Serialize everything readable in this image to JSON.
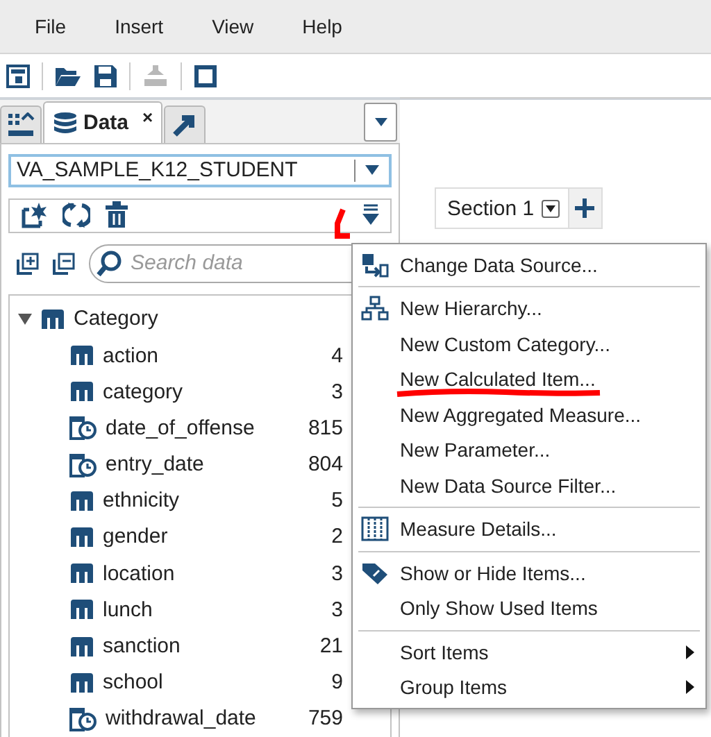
{
  "menu_bar": [
    {
      "label": "File"
    },
    {
      "label": "Insert"
    },
    {
      "label": "View"
    },
    {
      "label": "Help"
    }
  ],
  "toolbar": [
    {
      "kind": "report"
    },
    {
      "kind": "sep"
    },
    {
      "kind": "open"
    },
    {
      "kind": "save"
    },
    {
      "kind": "sep"
    },
    {
      "kind": "pdf",
      "disabled": true
    },
    {
      "kind": "sep"
    },
    {
      "kind": "frame"
    }
  ],
  "panel_tabs": [
    {
      "kind": "objects",
      "selected": false
    },
    {
      "kind": "data",
      "label": "Data",
      "close": "×",
      "selected": true
    },
    {
      "kind": "shared",
      "selected": false
    }
  ],
  "data_source": {
    "value": "VA_SAMPLE_K12_STUDENT"
  },
  "search": {
    "placeholder": "Search data"
  },
  "tree": {
    "label": "Category",
    "expanded": true,
    "children": [
      {
        "name": "action",
        "kind": "category",
        "value": "4"
      },
      {
        "name": "category",
        "kind": "category",
        "value": "3"
      },
      {
        "name": "date_of_offense",
        "kind": "date",
        "value": "815"
      },
      {
        "name": "entry_date",
        "kind": "date",
        "value": "804"
      },
      {
        "name": "ethnicity",
        "kind": "category",
        "value": "5"
      },
      {
        "name": "gender",
        "kind": "category",
        "value": "2"
      },
      {
        "name": "location",
        "kind": "category",
        "value": "3"
      },
      {
        "name": "lunch",
        "kind": "category",
        "value": "3"
      },
      {
        "name": "sanction",
        "kind": "category",
        "value": "21"
      },
      {
        "name": "school",
        "kind": "category",
        "value": "9"
      },
      {
        "name": "withdrawal_date",
        "kind": "date",
        "value": "759"
      }
    ]
  },
  "section_tabs": [
    {
      "label": "Section 1",
      "selected": true
    }
  ],
  "context_menu": [
    [
      {
        "label": "Change Data Source...",
        "kind": "source",
        "submenu": false,
        "annotated": false
      }
    ],
    [
      {
        "label": "New Hierarchy...",
        "kind": "hierarchy",
        "submenu": false,
        "annotated": false
      },
      {
        "label": "New Custom Category...",
        "kind": "none",
        "submenu": false,
        "annotated": false
      },
      {
        "label": "New Calculated Item...",
        "kind": "none",
        "submenu": false,
        "annotated": true
      },
      {
        "label": "New Aggregated Measure...",
        "kind": "none",
        "submenu": false,
        "annotated": false
      },
      {
        "label": "New Parameter...",
        "kind": "none",
        "submenu": false,
        "annotated": false
      },
      {
        "label": "New Data Source Filter...",
        "kind": "none",
        "submenu": false,
        "annotated": false
      }
    ],
    [
      {
        "label": "Measure Details...",
        "kind": "measure",
        "submenu": false,
        "annotated": false
      }
    ],
    [
      {
        "label": "Show or Hide Items...",
        "kind": "showhide",
        "submenu": false,
        "annotated": false
      },
      {
        "label": "Only Show Used Items",
        "kind": "none",
        "submenu": false,
        "annotated": false
      }
    ],
    [
      {
        "label": "Sort Items",
        "kind": "none",
        "submenu": true,
        "annotated": false
      },
      {
        "label": "Group Items",
        "kind": "none",
        "submenu": true,
        "annotated": false
      }
    ]
  ]
}
